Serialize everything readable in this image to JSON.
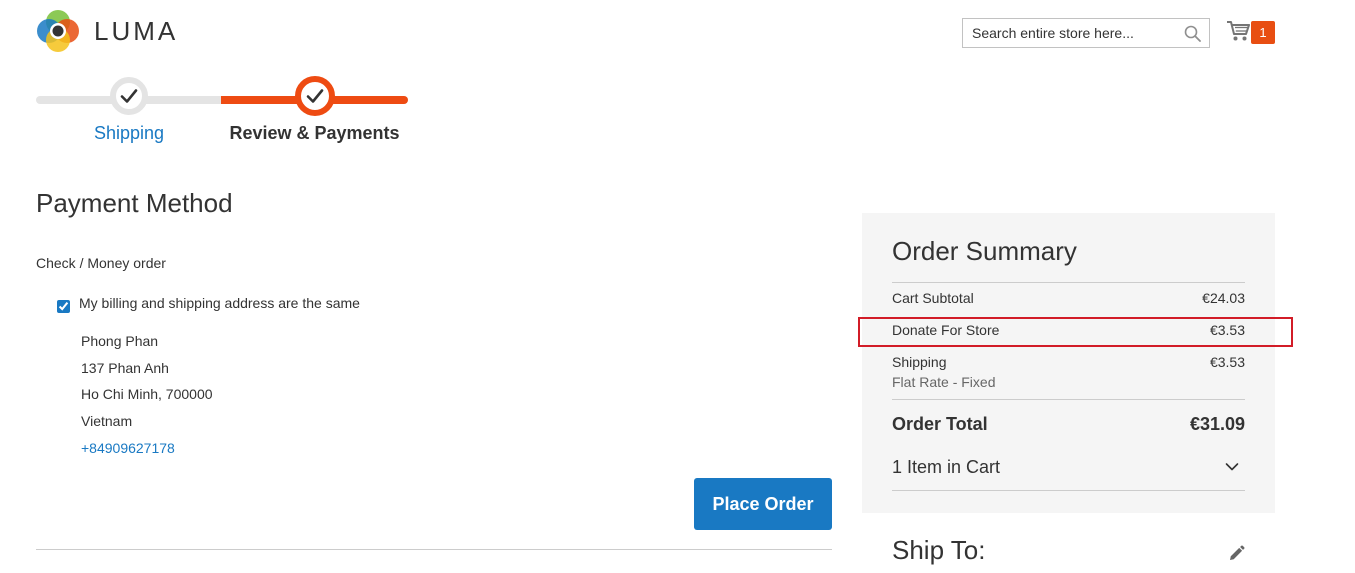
{
  "header": {
    "logo_text": "LUMA",
    "search": {
      "placeholder": "Search entire store here..."
    },
    "cart": {
      "count": "1"
    }
  },
  "progress": {
    "steps": [
      {
        "label": "Shipping",
        "status": "complete"
      },
      {
        "label": "Review & Payments",
        "status": "current"
      }
    ]
  },
  "payment": {
    "title": "Payment Method",
    "method_label": "Check / Money order",
    "billing_same_label": "My billing and shipping address are the same",
    "billing_same_checked": true,
    "address": {
      "name": "Phong Phan",
      "street": "137 Phan Anh",
      "city_line": "Ho Chi Minh, 700000",
      "country": "Vietnam",
      "phone": "+84909627178"
    },
    "place_order_label": "Place Order"
  },
  "summary": {
    "title": "Order Summary",
    "rows": [
      {
        "label": "Cart Subtotal",
        "amount": "€24.03"
      },
      {
        "label": "Donate For Store",
        "amount": "€3.53"
      },
      {
        "label": "Shipping",
        "amount": "€3.53",
        "sub": "Flat Rate - Fixed"
      }
    ],
    "total_label": "Order Total",
    "total_amount": "€31.09",
    "items_in_cart": "1 Item in Cart",
    "ship_to_title": "Ship To:"
  },
  "colors": {
    "accent_blue": "#1979c3",
    "progress_orange": "#ee4b12",
    "cart_badge": "#e84e12",
    "highlight_red": "#d21c27"
  },
  "icons": {
    "logo": "luma-logo-icon",
    "search": "search-icon",
    "cart": "shopping-cart-icon",
    "step_done": "checkmark-icon",
    "items_toggle": "chevron-down-icon",
    "ship_to_edit": "pencil-icon"
  }
}
